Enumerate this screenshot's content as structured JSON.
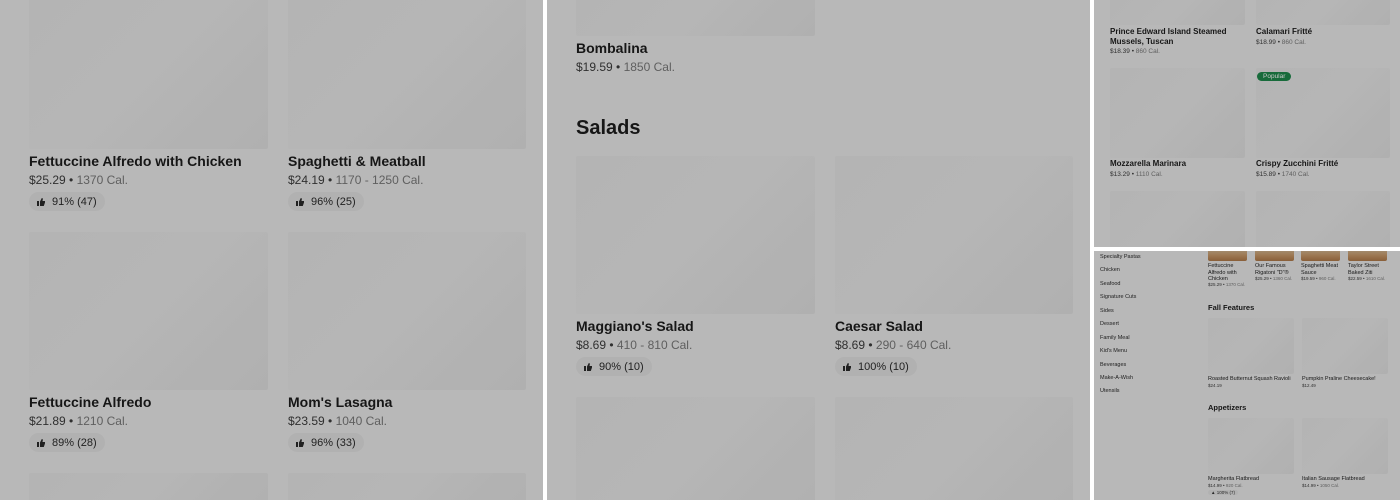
{
  "panel1": {
    "items": [
      {
        "name": "Fettuccine Alfredo with Chicken",
        "price": "$25.29",
        "cal": "1370 Cal.",
        "rating": "91% (47)"
      },
      {
        "name": "Spaghetti & Meatball",
        "price": "$24.19",
        "cal": "1170 - 1250 Cal.",
        "rating": "96% (25)"
      },
      {
        "name": "Fettuccine Alfredo",
        "price": "$21.89",
        "cal": "1210 Cal.",
        "rating": "89% (28)"
      },
      {
        "name": "Mom's Lasagna",
        "price": "$23.59",
        "cal": "1040 Cal.",
        "rating": "96% (33)"
      }
    ]
  },
  "panel2": {
    "top_item": {
      "name": "Bombalina",
      "price": "$19.59",
      "cal": "1850 Cal."
    },
    "section_title": "Salads",
    "items": [
      {
        "name": "Maggiano's Salad",
        "price": "$8.69",
        "cal": "410 - 810 Cal.",
        "rating": "90% (10)"
      },
      {
        "name": "Caesar Salad",
        "price": "$8.69",
        "cal": "290 - 640 Cal.",
        "rating": "100% (10)"
      }
    ]
  },
  "panel3": {
    "items": [
      {
        "name": "Prince Edward Island Steamed Mussels, Tuscan",
        "price": "$18.39",
        "cal": "860 Cal."
      },
      {
        "name": "Calamari Fritté",
        "price": "$18.99",
        "cal": "860 Cal."
      },
      {
        "name": "Mozzarella Marinara",
        "price": "$13.29",
        "cal": "1110 Cal."
      },
      {
        "name": "Crispy Zucchini Fritté",
        "price": "$15.89",
        "cal": "1740 Cal."
      }
    ],
    "badge": "Popular"
  },
  "panel4": {
    "sidebar": [
      "Specialty Pastas",
      "Chicken",
      "Seafood",
      "Signature Cuts",
      "Sides",
      "Dessert",
      "Family Meal",
      "Kid's Menu",
      "Beverages",
      "Make-A-Wish",
      "Utensils"
    ],
    "featured": [
      {
        "name": "Fettuccine Alfredo with Chicken",
        "price": "$25.29",
        "cal": "1370 Cal."
      },
      {
        "name": "Our Famous Rigatoni \"D\"®",
        "price": "$25.29",
        "cal": "1360 Cal."
      },
      {
        "name": "Spaghetti Meat Sauce",
        "price": "$19.59",
        "cal": "960 Cal."
      },
      {
        "name": "Taylor Street Baked Ziti",
        "price": "$22.59",
        "cal": "1610 Cal."
      }
    ],
    "fall_title": "Fall Features",
    "fall_items": [
      {
        "name": "Roasted Butternut Squash Ravioli",
        "price": "$24.19"
      },
      {
        "name": "Pumpkin Praline Cheesecake!",
        "price": "$12.49"
      }
    ],
    "appetizers_title": "Appetizers",
    "appetizer_items": [
      {
        "name": "Margherita Flatbread",
        "price": "$14.99",
        "cal": "920 Cal.",
        "rating": "100% (7)"
      },
      {
        "name": "Italian Sausage Flatbread",
        "price": "$14.99",
        "cal": "1050 Cal."
      }
    ]
  }
}
